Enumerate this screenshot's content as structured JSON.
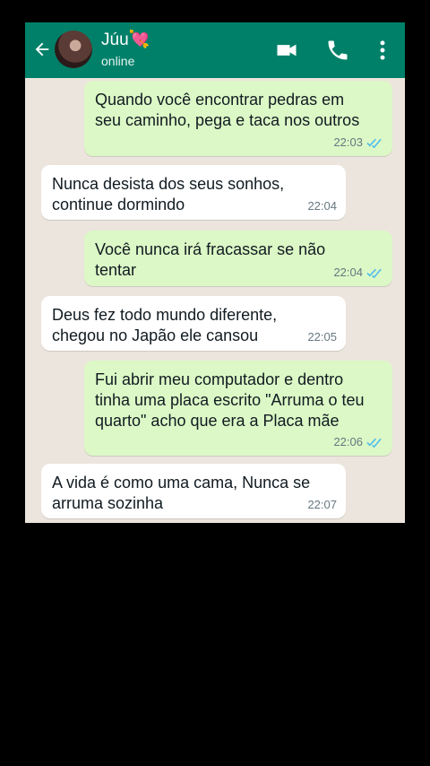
{
  "contact": {
    "name": "Júu💘",
    "status": "online"
  },
  "icons": {
    "back": "arrow-left-icon",
    "video": "video-camera-icon",
    "call": "phone-icon",
    "menu": "more-vert-icon",
    "read": "double-check-icon"
  },
  "colors": {
    "header": "#008069",
    "outgoing": "#dcf8c6",
    "incoming": "#ffffff",
    "chat_bg": "#ece5dd",
    "read_ticks": "#53bdeb"
  },
  "messages": [
    {
      "direction": "out",
      "text": "Quando você encontrar pedras em\nseu caminho, pega e taca nos outros",
      "time": "22:03",
      "read": true
    },
    {
      "direction": "in",
      "text": "Nunca desista dos seus sonhos,\ncontinue dormindo",
      "time": "22:04"
    },
    {
      "direction": "out",
      "text": "Você nunca irá fracassar se não\ntentar",
      "time": "22:04",
      "read": true
    },
    {
      "direction": "in",
      "text": "Deus fez todo mundo diferente,\nchegou no Japão ele cansou",
      "time": "22:05"
    },
    {
      "direction": "out",
      "text": "Fui abrir meu computador e dentro\ntinha uma placa escrito \"Arruma o teu\nquarto\" acho que era a Placa mãe",
      "time": "22:06",
      "read": true
    },
    {
      "direction": "in",
      "text": "A vida é como uma cama, Nunca se\narruma sozinha",
      "time": "22:07"
    }
  ]
}
